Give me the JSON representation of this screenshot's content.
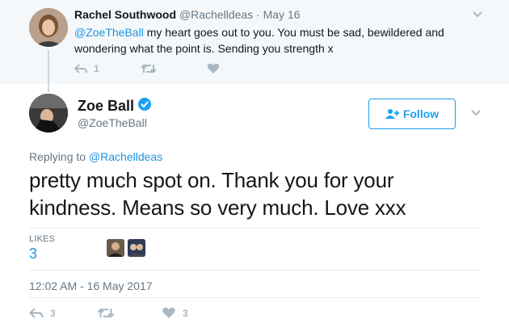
{
  "parent_tweet": {
    "name": "Rachel Southwood",
    "handle": "@Rachelldeas",
    "separator": "·",
    "date": "May 16",
    "mention": "@ZoeTheBall",
    "text": " my heart goes out to you. You must be sad, bewildered and wondering what the point is. Sending you strength x",
    "reply_count": "1",
    "retweet_count": "",
    "like_count": ""
  },
  "main_tweet": {
    "name": "Zoe Ball",
    "handle": "@ZoeTheBall",
    "follow_label": "Follow",
    "replying_prefix": "Replying to ",
    "replying_to": "@Rachelldeas",
    "text": "pretty much spot on. Thank you for your kindness. Means so very much. Love xxx",
    "likes_label": "LIKES",
    "likes_value": "3",
    "timestamp": "12:02 AM - 16 May 2017",
    "reply_count": "3",
    "retweet_count": "",
    "like_count": "3"
  },
  "colors": {
    "accent": "#1da1f2",
    "link": "#1b95e0",
    "muted": "#657786",
    "icon": "#aab8c2",
    "parent_bg": "#f5f8fa"
  },
  "icons": {
    "reply": "reply-icon",
    "retweet": "retweet-icon",
    "like": "heart-icon",
    "caret": "chevron-down-icon",
    "verified": "verified-badge-icon",
    "follow": "add-user-icon"
  }
}
